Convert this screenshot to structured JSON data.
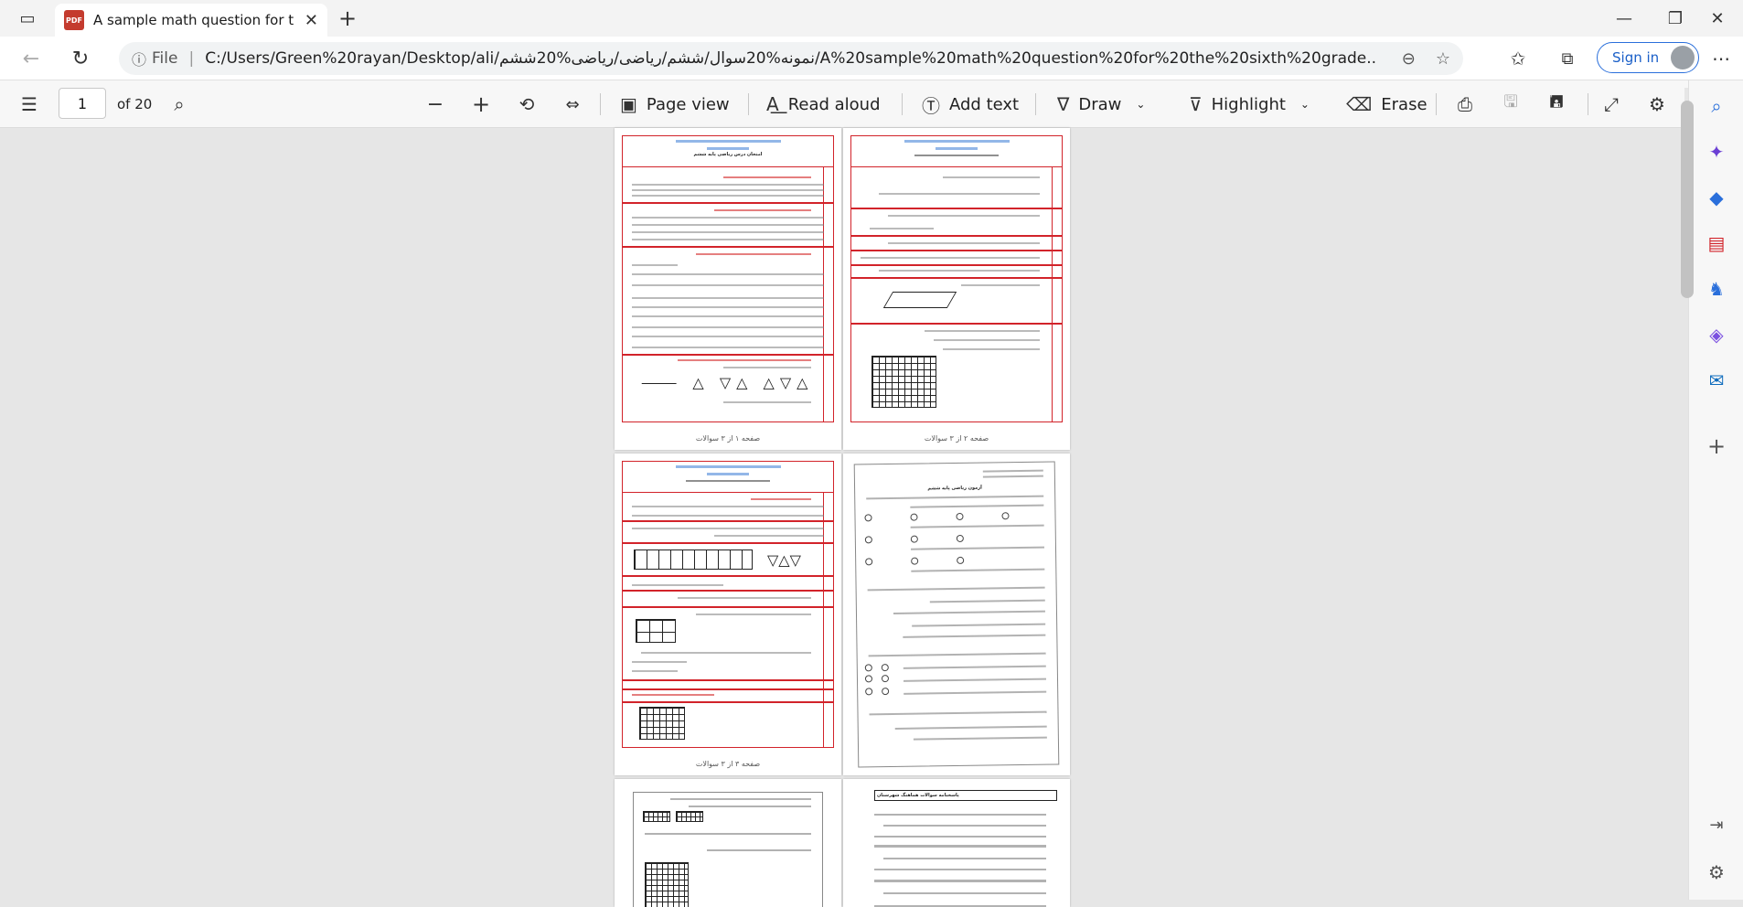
{
  "browser": {
    "tab_title": "A sample math question for the s",
    "tab_icon": "PDF",
    "new_tab": "+",
    "address_file_label": "File",
    "url": "C:/Users/Green%20rayan/Desktop/ali/نمونه%20سوال/ششم/ریاضی/ریاضی%20ششم/A%20sample%20math%20question%20for%20the%20sixth%20grade...",
    "sign_in": "Sign in"
  },
  "pdf_toolbar": {
    "page_number": "1",
    "page_total": "of 20",
    "page_view": "Page view",
    "read_aloud": "Read aloud",
    "add_text": "Add text",
    "draw": "Draw",
    "highlight": "Highlight",
    "erase": "Erase"
  },
  "thumbnails": {
    "p1_footer": "صفحه ۱ از ۳ سوالات",
    "p2_footer": "صفحه ۲ از ۳ سوالات",
    "p3_footer": "صفحه ۳ از ۳ سوالات",
    "p1_title": "امتحان درس ریاضی پایه ششم",
    "p4_title": "آزمون ریاضی پایه ششم",
    "p6_title": "پاسخنامه سوالات هماهنگ شهرستان"
  },
  "colors": {
    "accent": "#2a6fdb",
    "frame_red": "#d2232a",
    "pdf_icon": "#c43b2e"
  }
}
